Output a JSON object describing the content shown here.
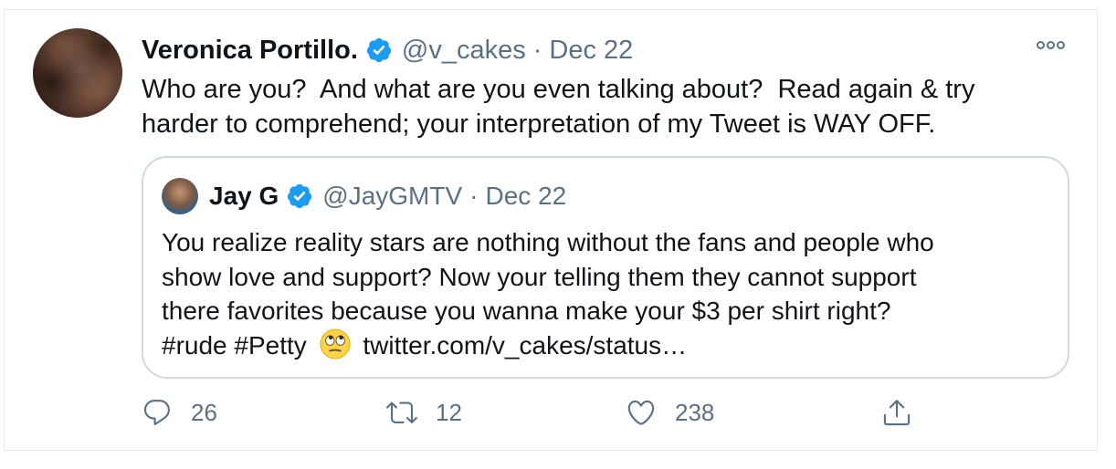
{
  "tweet": {
    "author": {
      "display_name": "Veronica Portillo.",
      "handle": "@v_cakes",
      "separator": "·",
      "date": "Dec 22"
    },
    "text_line1": "Who are you?  And what are you even talking about?  Read again & try",
    "text_line2": "harder to comprehend; your interpretation of my Tweet is WAY OFF."
  },
  "quoted_tweet": {
    "author": {
      "display_name": "Jay G",
      "handle": "@JayGMTV",
      "separator": "·",
      "date": "Dec 22"
    },
    "line1": "You realize reality stars are nothing without the fans and people who",
    "line2": "show love and support? Now your telling them they cannot support",
    "line3": "there favorites because you wanna make your $3 per shirt right?",
    "line4_before_emoji": "#rude #Petty",
    "line4_after_emoji": "twitter.com/v_cakes/status…",
    "emoji": "eye-roll-emoji"
  },
  "actions": {
    "reply_count": "26",
    "retweet_count": "12",
    "like_count": "238"
  },
  "icons": {
    "verified": "verified-badge-icon",
    "more": "more-options-icon",
    "reply": "reply-icon",
    "retweet": "retweet-icon",
    "like": "heart-icon",
    "share": "share-icon"
  },
  "colors": {
    "verified_blue": "#1d9bf0",
    "secondary_text": "#5b7083",
    "border": "#cfd9de"
  }
}
